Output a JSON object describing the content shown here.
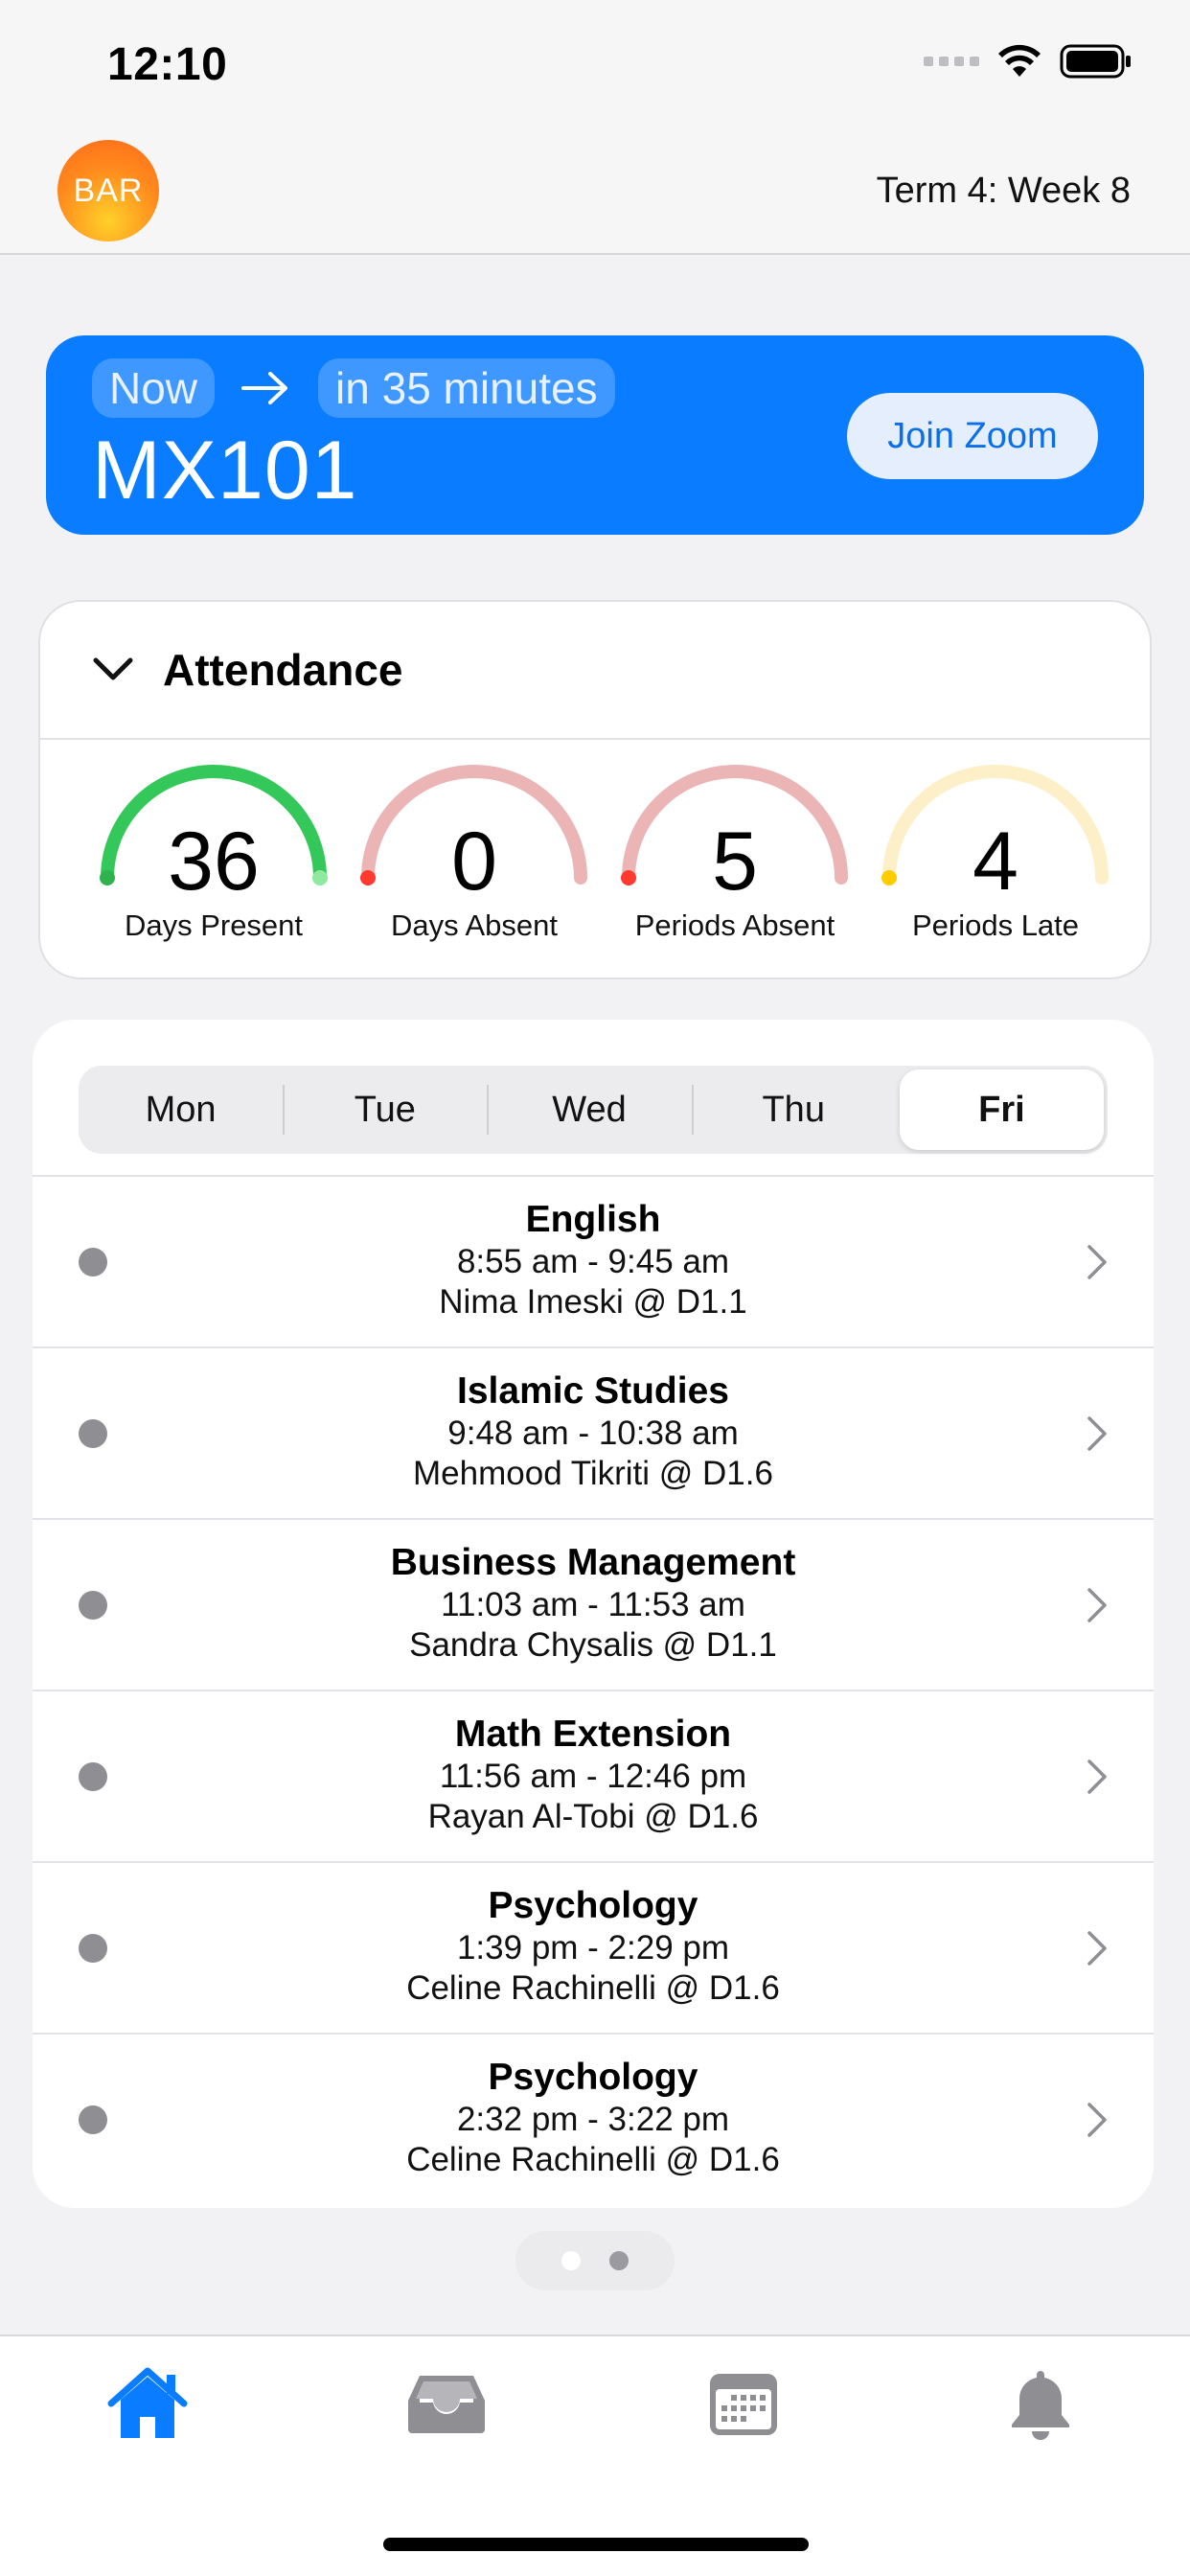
{
  "status_bar": {
    "time": "12:10"
  },
  "header": {
    "avatar_initials": "BAR",
    "term": "Term 4: Week 8"
  },
  "now_card": {
    "now_label": "Now",
    "next_label": "in 35 minutes",
    "course": "MX101",
    "join_label": "Join Zoom",
    "color": "#0a7cff"
  },
  "attendance": {
    "title": "Attendance",
    "stats": [
      {
        "value": "36",
        "label": "Days Present",
        "color": "#34c759",
        "track": "#34c759"
      },
      {
        "value": "0",
        "label": "Days Absent",
        "color": "#ff3b30",
        "track": "#ebb5b5"
      },
      {
        "value": "5",
        "label": "Periods Absent",
        "color": "#ff3b30",
        "track": "#ebb5b5"
      },
      {
        "value": "4",
        "label": "Periods Late",
        "color": "#ffcc00",
        "track": "#fdf0c8"
      }
    ]
  },
  "timetable": {
    "days": [
      "Mon",
      "Tue",
      "Wed",
      "Thu",
      "Fri"
    ],
    "selected_day": "Fri",
    "lessons": [
      {
        "subject": "English",
        "time": "8:55 am - 9:45 am",
        "teacher": "Nima Imeski @ D1.1"
      },
      {
        "subject": "Islamic Studies",
        "time": "9:48 am - 10:38 am",
        "teacher": "Mehmood Tikriti @ D1.6"
      },
      {
        "subject": "Business Management",
        "time": "11:03 am - 11:53 am",
        "teacher": "Sandra Chysalis @ D1.1"
      },
      {
        "subject": "Math Extension",
        "time": "11:56 am - 12:46 pm",
        "teacher": "Rayan Al-Tobi @ D1.6"
      },
      {
        "subject": "Psychology",
        "time": "1:39 pm - 2:29 pm",
        "teacher": "Celine Rachinelli @ D1.6"
      },
      {
        "subject": "Psychology",
        "time": "2:32 pm - 3:22 pm",
        "teacher": "Celine Rachinelli @ D1.6"
      }
    ]
  },
  "pager": {
    "pages": 2,
    "current": 1
  },
  "tab_bar": {
    "tabs": [
      {
        "icon": "home-icon",
        "active": true
      },
      {
        "icon": "inbox-icon",
        "active": false
      },
      {
        "icon": "calendar-icon",
        "active": false
      },
      {
        "icon": "bell-icon",
        "active": false
      }
    ],
    "active_color": "#0a7cff",
    "inactive_color": "#8e8e93"
  }
}
